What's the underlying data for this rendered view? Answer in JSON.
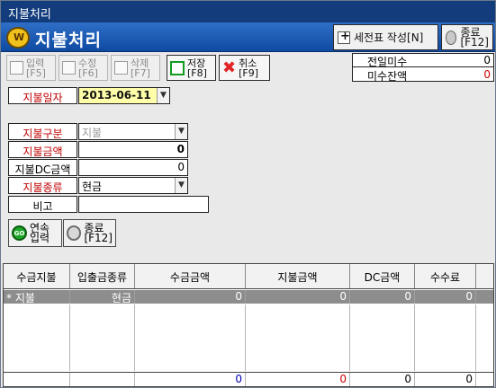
{
  "window": {
    "title": "지불처리"
  },
  "header": {
    "title": "지불처리",
    "invoice_button": "세전표 작성[N]",
    "close_button": {
      "line1": "종료",
      "line2": "[F12]"
    }
  },
  "toolbar": {
    "input": {
      "line1": "입력",
      "line2": "[F5]"
    },
    "edit": {
      "line1": "수정",
      "line2": "[F6]"
    },
    "delete": {
      "line1": "삭제",
      "line2": "[F7]"
    },
    "save": {
      "line1": "저장",
      "line2": "[F8]"
    },
    "cancel": {
      "line1": "취소",
      "line2": "[F9]"
    }
  },
  "summary": {
    "prev_unpaid_label": "전일미수",
    "prev_unpaid_value": "0",
    "unpaid_balance_label": "미수잔액",
    "unpaid_balance_value": "0"
  },
  "form": {
    "payment_date_label": "지불일자",
    "payment_date_value": "2013-06-11",
    "payment_type_label": "지불구분",
    "payment_type_value": "지불",
    "payment_amount_label": "지불금액",
    "payment_amount_value": "0",
    "payment_dc_label": "지불DC금액",
    "payment_dc_value": "0",
    "payment_kind_label": "지불종류",
    "payment_kind_value": "현금",
    "remarks_label": "비고",
    "remarks_value": ""
  },
  "actions": {
    "continuous": {
      "line1": "연속",
      "line2": "입력"
    },
    "end": {
      "line1": "종료",
      "line2": "[F12]"
    }
  },
  "table": {
    "headers": [
      "수금지불",
      "입출금종류",
      "수금금액",
      "지불금액",
      "DC금액",
      "수수료"
    ],
    "row": {
      "marker": "*",
      "type": "지불",
      "kind": "현금",
      "receipt_amount": "0",
      "payment_amount": "0",
      "dc_amount": "0",
      "fee": "0"
    },
    "footer": {
      "receipt_amount": "0",
      "payment_amount": "0",
      "dc_amount": "0",
      "fee": "0"
    }
  }
}
